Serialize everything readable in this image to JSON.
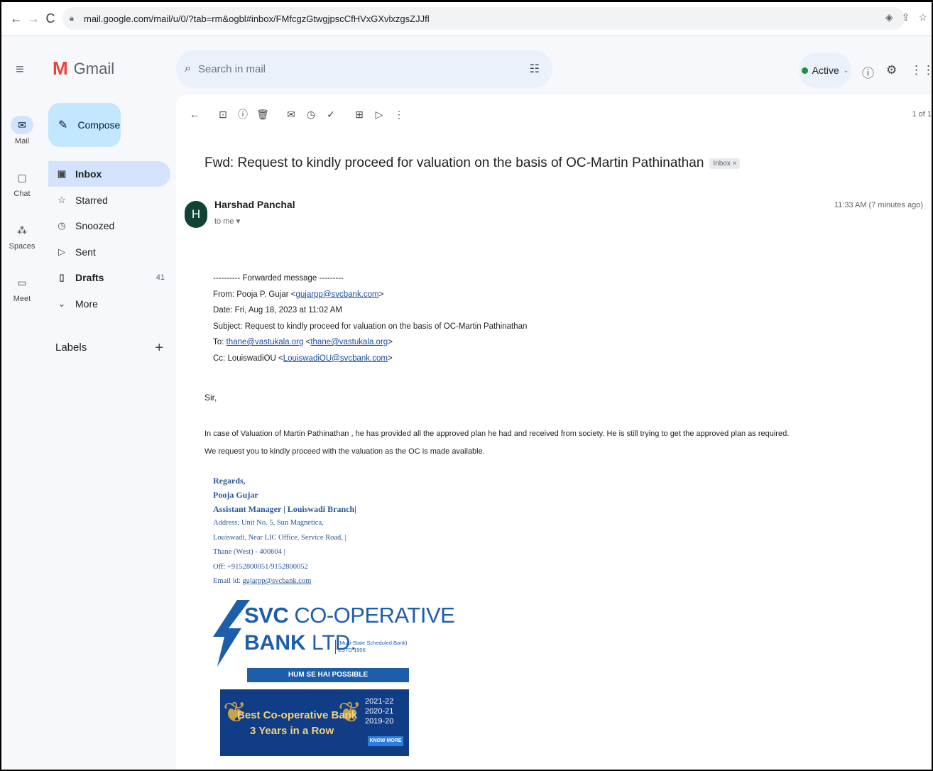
{
  "browser": {
    "url": "mail.google.com/mail/u/0/?tab=rm&ogbl#inbox/FMfcgzGtwgjpscCfHVxGXvlxzgsZJJfl"
  },
  "rail": {
    "items": [
      {
        "label": "Mail",
        "icon": "mail-icon"
      },
      {
        "label": "Chat",
        "icon": "chat-icon"
      },
      {
        "label": "Spaces",
        "icon": "spaces-icon"
      },
      {
        "label": "Meet",
        "icon": "meet-icon"
      }
    ]
  },
  "header": {
    "app_name": "Gmail",
    "search_placeholder": "Search in mail",
    "status": "Active",
    "status_color": "#1e8e3e"
  },
  "sidebar": {
    "compose_label": "Compose",
    "items": [
      {
        "label": "Inbox",
        "icon": "inbox-icon"
      },
      {
        "label": "Starred",
        "icon": "star-icon"
      },
      {
        "label": "Snoozed",
        "icon": "clock-icon"
      },
      {
        "label": "Sent",
        "icon": "send-icon"
      },
      {
        "label": "Drafts",
        "icon": "draft-icon",
        "count": "41"
      },
      {
        "label": "More",
        "icon": "chevron-down-icon"
      }
    ],
    "labels_heading": "Labels"
  },
  "thread": {
    "pager": "1 of 1",
    "subject": "Fwd: Request to kindly proceed for valuation on the basis of OC-Martin Pathinathan",
    "chip": "Inbox ×",
    "avatar_letter": "H",
    "avatar_color": "#104335",
    "sender": "Harshad Panchal",
    "to": "to me ▾",
    "time": "11:33 AM (7 minutes ago)"
  },
  "message": {
    "forward_header": "---------- Forwarded message ---------",
    "from_label": "From: ",
    "from_name": "Pooja P. Gujar",
    "from_email": "gujarpp@svcbank.com",
    "date": "Date: Fri, Aug 18, 2023 at 11:02 AM",
    "subject": "Subject: Request to kindly proceed for valuation on the basis of OC-Martin Pathinathan",
    "to_label": "To: ",
    "to_email": "thane@vastukala.org",
    "to_email2": "thane@vastukala.org",
    "cc_label": "Cc: LouiswadiOU <",
    "cc_email": "LouiswadiOU@svcbank.com",
    "greeting": "Sir,",
    "para1": "In case of Valuation of Martin Pathinathan , he has provided all the approved plan he had and received from society. He is still trying to get the approved plan as required.",
    "para2": "We request you to kindly proceed with the valuation as the OC is made available."
  },
  "signature": {
    "regards": "Regards,",
    "name": "Pooja Gujar",
    "title": "Assistant Manager | Louiswadi Branch|",
    "addr1": "Address: Unit No. 5, Sun Magnetica,",
    "addr2": "Louiswadi, Near LIC Office, Service Road, |",
    "addr3": "Thane (West) - 400604 |",
    "phone": "Off: +9152800051/9152800052",
    "email_label": "Email id: ",
    "email": "gujarpp@svcbank.com"
  },
  "bank_logo": {
    "line1_bold": "SVC",
    "line1_rest": " CO-OPERATIVE",
    "line2_bold": "BANK",
    "line2_rest": " LTD.",
    "tag1": "(Multi-State Scheduled Bank)",
    "tag2": "ESTD 1906",
    "strip": "HUM SE HAI POSSIBLE",
    "color": "#1d5eab"
  },
  "banner": {
    "line1": "Best Co-operative Bank",
    "line2": "3 Years in a Row",
    "year1": "2021-22",
    "year2": "2020-21",
    "year3": "2019-20",
    "cta": "KNOW MORE"
  }
}
